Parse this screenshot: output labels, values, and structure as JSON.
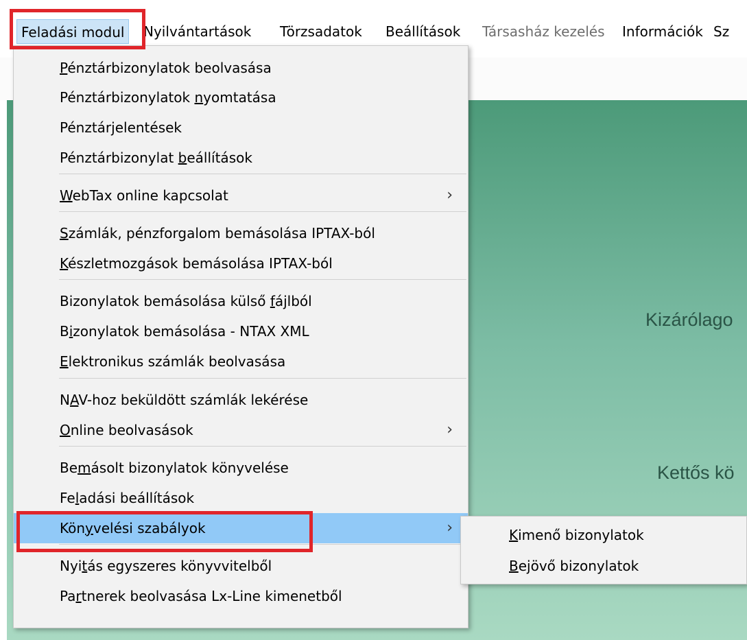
{
  "menubar": {
    "items": [
      {
        "label": "Feladási modul",
        "state": "active"
      },
      {
        "label": "Nyilvántartások",
        "state": "normal"
      },
      {
        "label": "Törzsadatok",
        "state": "normal"
      },
      {
        "label": "Beállítások",
        "state": "normal"
      },
      {
        "label": "Társasház kezelés",
        "state": "disabled"
      },
      {
        "label": "Információk",
        "state": "normal"
      },
      {
        "label": "Sz",
        "state": "normal"
      }
    ]
  },
  "background": {
    "text1": "Kizárólago",
    "text2": "Kettős kö"
  },
  "dropdown": {
    "items": [
      {
        "pre": "",
        "ul": "P",
        "post": "énztárbizonylatok beolvasása"
      },
      {
        "pre": "Pénztárbizonylatok ",
        "ul": "n",
        "post": "yomtatása"
      },
      {
        "pre": "Pénztár",
        "ul": "j",
        "post": "elentések"
      },
      {
        "pre": "Pénztárbizonylat ",
        "ul": "b",
        "post": "eállítások"
      },
      {
        "pre": "",
        "ul": "W",
        "post": "ebTax online kapcsolat",
        "submenu": true
      },
      {
        "pre": "",
        "ul": "S",
        "post": "zámlák, pénzforgalom bemásolása IPTAX-ból"
      },
      {
        "pre": "",
        "ul": "K",
        "post": "észletmozgások bemásolása IPTAX-ból"
      },
      {
        "pre": "Bizonylatok bemásolása külső ",
        "ul": "f",
        "post": "ájlból"
      },
      {
        "pre": "B",
        "ul": "i",
        "post": "zonylatok bemásolása - NTAX XML"
      },
      {
        "pre": "",
        "ul": "E",
        "post": "lektronikus számlák beolvasása"
      },
      {
        "pre": "N",
        "ul": "A",
        "post": "V-hoz beküldött számlák lekérése"
      },
      {
        "pre": "",
        "ul": "O",
        "post": "nline beolvasások",
        "submenu": true
      },
      {
        "pre": "Be",
        "ul": "m",
        "post": "ásolt bizonylatok könyvelése"
      },
      {
        "pre": "Fe",
        "ul": "l",
        "post": "adási beállítások"
      },
      {
        "pre": "Kön",
        "ul": "y",
        "post": "velési szabályok",
        "submenu": true,
        "highlighted": true
      },
      {
        "pre": "Nyi",
        "ul": "t",
        "post": "ás egyszeres könyvvitelből"
      },
      {
        "pre": "Pa",
        "ul": "r",
        "post": "tnerek beolvasása Lx-Line kimenetből"
      }
    ],
    "chevron": "›"
  },
  "submenu": {
    "items": [
      {
        "pre": "",
        "ul": "K",
        "post": "imenő bizonylatok"
      },
      {
        "pre": "",
        "ul": "B",
        "post": "ejövő bizonylatok"
      }
    ]
  },
  "colors": {
    "highlight": "#91c9f7",
    "annotation_red": "#e0252a",
    "menu_bg": "#f2f2f2",
    "content_green": "#4c9a79"
  }
}
